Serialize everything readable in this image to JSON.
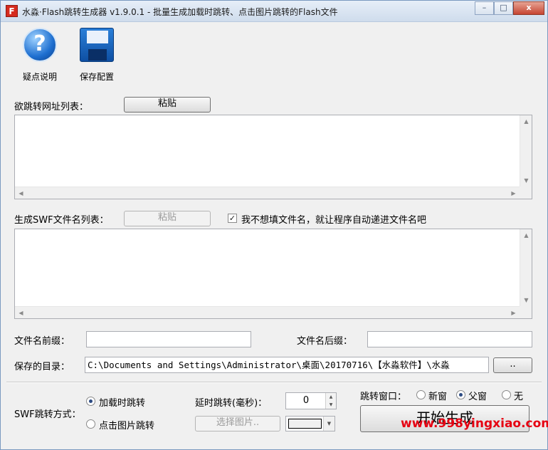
{
  "window": {
    "icon_letter": "F",
    "title": "水淼·Flash跳转生成器 v1.9.0.1 - 批量生成加载时跳转、点击图片跳转的Flash文件",
    "minimize": "–",
    "maximize": "□",
    "close": "x"
  },
  "toolbar": {
    "help_icon": "?",
    "help_label": "疑点说明",
    "save_label": "保存配置"
  },
  "url_list": {
    "label": "欲跳转网址列表：",
    "paste_label": "粘贴"
  },
  "swf_list": {
    "label": "生成SWF文件名列表：",
    "paste_label": "粘贴",
    "auto_checked": true,
    "auto_label": "我不想填文件名，就让程序自动递进文件名吧"
  },
  "prefix": {
    "label": "文件名前缀：",
    "value": ""
  },
  "suffix": {
    "label": "文件名后缀：",
    "value": ""
  },
  "save_dir": {
    "label": "保存的目录：",
    "value": "C:\\Documents and Settings\\Administrator\\桌面\\20170716\\【水淼软件】\\水淼",
    "browse_label": ".."
  },
  "swf_mode": {
    "label": "SWF跳转方式：",
    "options": [
      {
        "label": "加载时跳转",
        "checked": true
      },
      {
        "label": "点击图片跳转",
        "checked": false
      }
    ]
  },
  "delay": {
    "label": "延时跳转(毫秒)：",
    "value": "0"
  },
  "select_image_label": "选择图片..",
  "jump_window": {
    "label": "跳转窗口：",
    "options": [
      {
        "label": "新窗",
        "checked": false
      },
      {
        "label": "父窗",
        "checked": true
      },
      {
        "label": "无",
        "checked": false
      }
    ]
  },
  "start_label": "开始生成",
  "watermark": "www.998yingxiao.com"
}
